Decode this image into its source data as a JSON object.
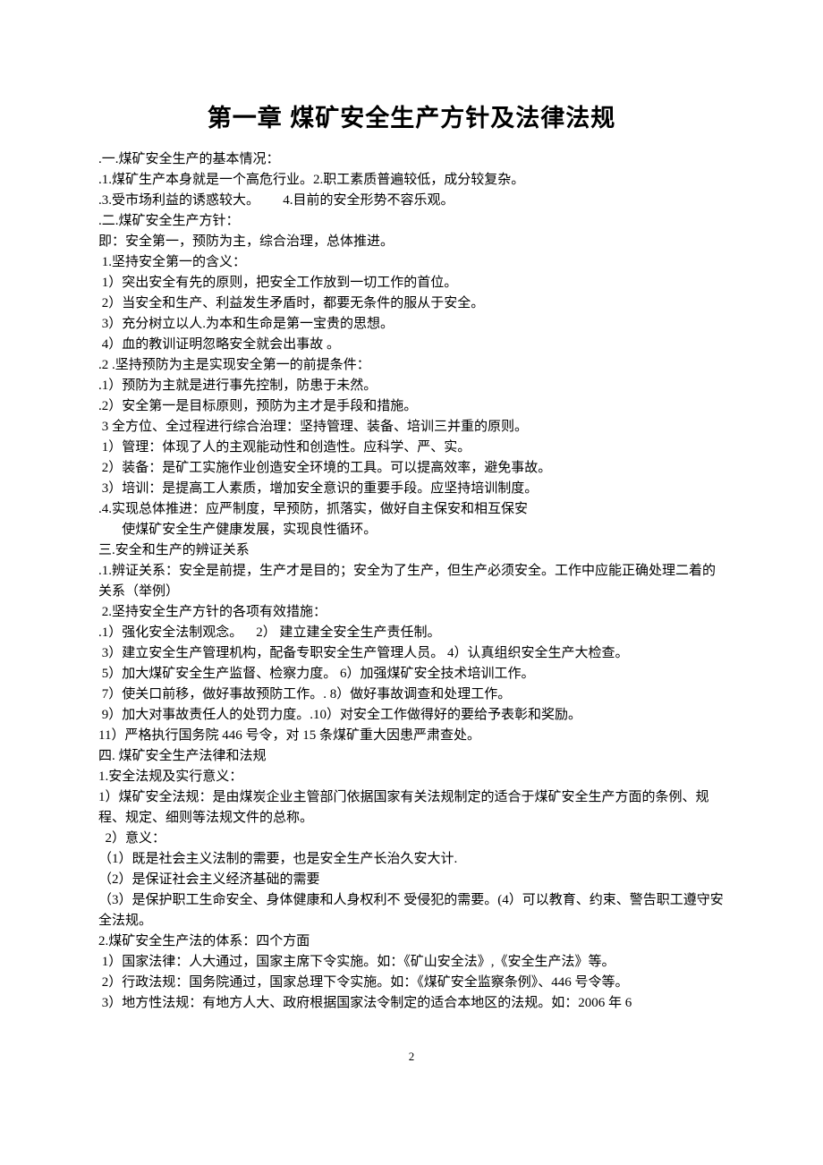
{
  "title": "第一章 煤矿安全生产方针及法律法规",
  "lines": [
    ".一.煤矿安全生产的基本情况：",
    ".1.煤矿生产本身就是一个高危行业。2.职工素质普遍较低，成分较复杂。",
    ".3.受市场利益的诱惑较大。       4.目前的安全形势不容乐观。",
    ".二.煤矿安全生产方针：",
    "即：安全第一，预防为主，综合治理，总体推进。",
    " 1.坚持安全第一的含义：",
    " 1）突出安全有先的原则，把安全工作放到一切工作的首位。",
    " 2）当安全和生产、利益发生矛盾时，都要无条件的服从于安全。",
    " 3）充分树立以人.为本和生命是第一宝贵的思想。",
    " 4）血的教训证明忽略安全就会出事故 。",
    ".2 .坚持预防为主是实现安全第一的前提条件：",
    ".1）预防为主就是进行事先控制，防患于未然。",
    ".2）安全第一是目标原则，预防为主才是手段和措施。",
    " 3 全方位、全过程进行综合治理：坚持管理、装备、培训三并重的原则。",
    " 1）管理：体现了人的主观能动性和创造性。应科学、严、实。",
    " 2）装备：是矿工实施作业创造安全环境的工具。可以提高效率，避免事故。",
    " 3）培训：是提高工人素质，增加安全意识的重要手段。应坚持培训制度。",
    ".4.实现总体推进：应严制度，早预防，抓落实，做好自主保安和相互保安",
    "       使煤矿安全生产健康发展，实现良性循环。",
    "三.安全和生产的辨证关系",
    ".1.辨证关系：安全是前提，生产才是目的；安全为了生产，但生产必须安全。工作中应能正确处理二着的关系（举例）",
    " 2.坚持安全生产方针的各项有效措施：",
    ".1）强化安全法制观念。    2） 建立建全安全生产责任制。",
    " 3）建立安全生产管理机构，配备专职安全生产管理人员。 4）认真组织安全生产大检查。",
    " 5）加大煤矿安全生产监督、检察力度。 6）加强煤矿安全技术培训工作。",
    " 7）使关口前移，做好事故预防工作。. 8）做好事故调查和处理工作。",
    " 9）加大对事故责任人的处罚力度。.10）对安全工作做得好的要给予表彰和奖励。",
    "11）严格执行国务院 446 号令，对 15 条煤矿重大因患严肃查处。",
    "四. 煤矿安全生产法律和法规",
    "1.安全法规及实行意义：",
    "1）煤矿安全法规：是由煤炭企业主管部门依据国家有关法规制定的适合于煤矿安全生产方面的条例、规程、规定、细则等法规文件的总称。",
    "  2）意义：",
    "（1）既是社会主义法制的需要，也是安全生产长治久安大计.",
    "（2）是保证社会主义经济基础的需要",
    "（3）是保护职工生命安全、身体健康和人身权利不 受侵犯的需要。(4）可以教育、约束、警告职工遵守安全法规。",
    "2.煤矿安全生产法的体系：四个方面",
    " 1）国家法律：人大通过，国家主席下令实施。如：《矿山安全法》,《安全生产法》等。",
    " 2）行政法规：国务院通过，国家总理下令实施。如：《煤矿安全监察条例》、446 号令等。",
    " 3）地方性法规：有地方人大、政府根据国家法令制定的适合本地区的法规。如：2006 年 6"
  ],
  "pageNumber": "2"
}
